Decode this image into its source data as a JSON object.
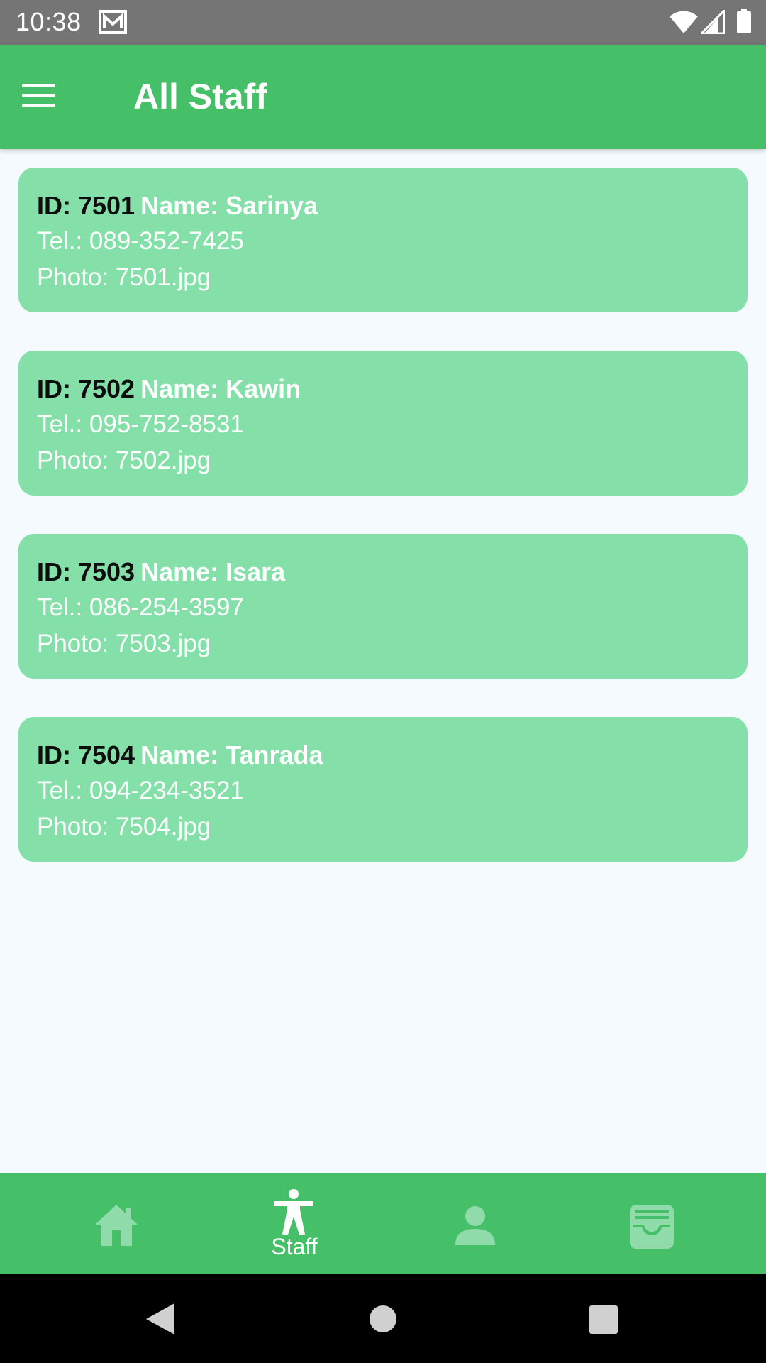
{
  "status_bar": {
    "time": "10:38",
    "icons": [
      "gmail-icon",
      "wifi-icon",
      "signal-icon",
      "battery-icon"
    ]
  },
  "app_bar": {
    "menu_icon": "menu-icon",
    "title": "All Staff"
  },
  "staff": [
    {
      "id_text": "ID: 7501",
      "name_text": "Name: Sarinya",
      "tel_text": "Tel.: 089-352-7425",
      "photo_text": "Photo: 7501.jpg"
    },
    {
      "id_text": "ID: 7502",
      "name_text": "Name: Kawin",
      "tel_text": "Tel.: 095-752-8531",
      "photo_text": "Photo: 7502.jpg"
    },
    {
      "id_text": "ID: 7503",
      "name_text": "Name: Isara",
      "tel_text": "Tel.: 086-254-3597",
      "photo_text": "Photo: 7503.jpg"
    },
    {
      "id_text": "ID: 7504",
      "name_text": "Name: Tanrada",
      "tel_text": "Tel.: 094-234-3521",
      "photo_text": "Photo: 7504.jpg"
    }
  ],
  "bottom_nav": {
    "items": [
      {
        "icon": "home-icon",
        "label": "",
        "active": false
      },
      {
        "icon": "person-standing-icon",
        "label": "Staff",
        "active": true
      },
      {
        "icon": "user-icon",
        "label": "",
        "active": false
      },
      {
        "icon": "inbox-icon",
        "label": "",
        "active": false
      }
    ]
  },
  "colors": {
    "primary": "#45c068",
    "card": "#84e0a8",
    "background": "#f4fafe",
    "inactive_icon": "#8fdcaa",
    "status_bar": "#757575"
  }
}
